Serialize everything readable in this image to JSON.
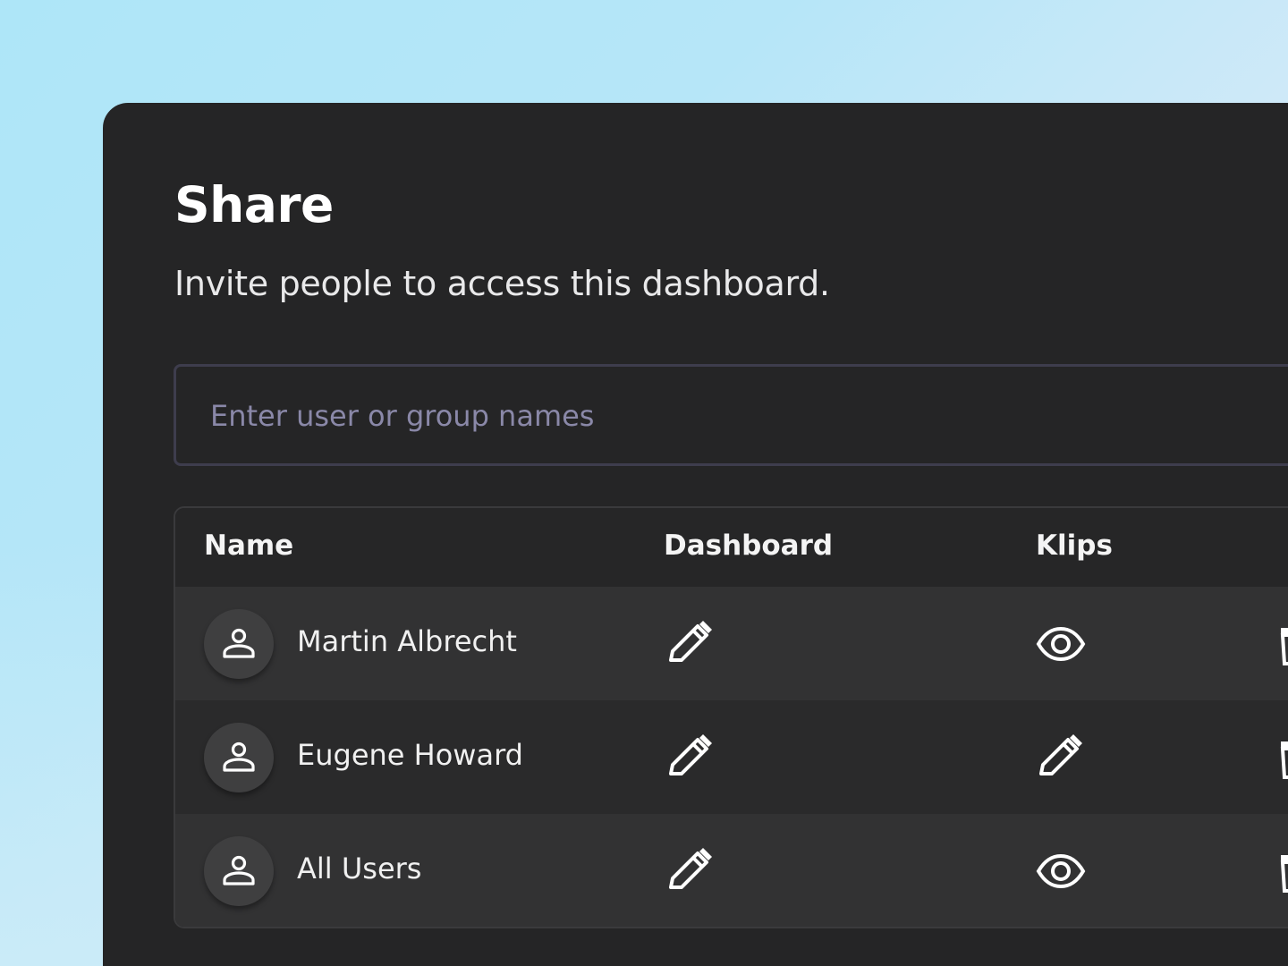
{
  "dialog": {
    "title": "Share",
    "subtitle": "Invite people to access this dashboard."
  },
  "search": {
    "placeholder": "Enter user or group names",
    "value": ""
  },
  "table": {
    "columns": [
      "Name",
      "Dashboard",
      "Klips"
    ],
    "rows": [
      {
        "name": "Martin Albrecht",
        "dashboard": "pencil-icon",
        "klips": "eye-icon"
      },
      {
        "name": "Eugene Howard",
        "dashboard": "pencil-icon",
        "klips": "pencil-icon"
      },
      {
        "name": "All Users",
        "dashboard": "pencil-icon",
        "klips": "eye-icon"
      }
    ]
  },
  "colors": {
    "panel": "#252526",
    "row_alt": "#323233",
    "placeholder": "#8a88a8"
  }
}
